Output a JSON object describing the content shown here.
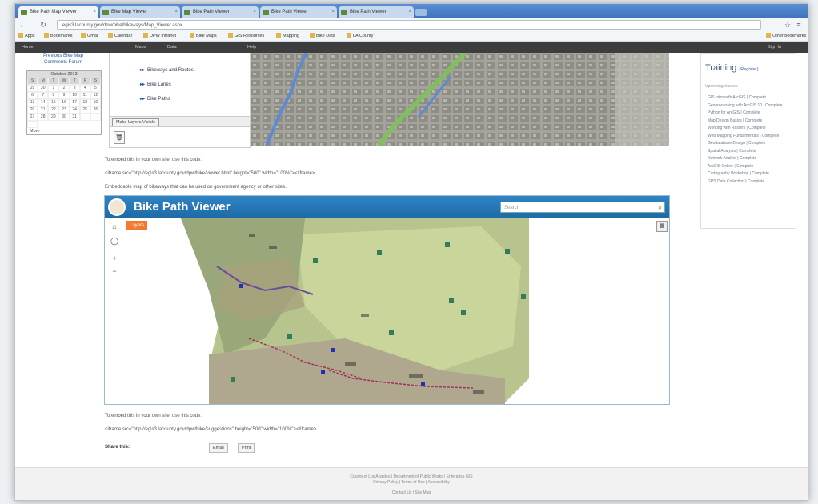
{
  "browser": {
    "tabs": [
      {
        "label": "Bike Path Map Viewer"
      },
      {
        "label": "Bike Map Viewer"
      },
      {
        "label": "Bike Path Viewer"
      },
      {
        "label": "Bike Path Viewer"
      },
      {
        "label": "Bike Path Viewer"
      }
    ],
    "url": "egis3.lacounty.gov/dpw/bike/bikeways/Map_Viewer.aspx",
    "bookmarks": [
      "Apps",
      "Bookmarks",
      "Gmail",
      "Calendar",
      "DPW Intranet",
      "Bike Maps",
      "GIS Resources",
      "Mapping",
      "Bike Data",
      "LA County",
      "Other bookmarks"
    ]
  },
  "top_bar": {
    "items": [
      "Home",
      "Maps",
      "Data",
      "Help",
      "Sign In"
    ]
  },
  "sidebar": {
    "links": [
      "Previous Bike Map",
      "Comments Forum"
    ],
    "calendar_title": "October 2013",
    "weekdays": [
      "S",
      "M",
      "T",
      "W",
      "T",
      "F",
      "S"
    ],
    "days": [
      "29",
      "30",
      "1",
      "2",
      "3",
      "4",
      "5",
      "6",
      "7",
      "8",
      "9",
      "10",
      "11",
      "12",
      "13",
      "14",
      "15",
      "16",
      "17",
      "18",
      "19",
      "20",
      "21",
      "22",
      "23",
      "24",
      "25",
      "26",
      "27",
      "28",
      "29",
      "30",
      "31",
      "",
      "",
      ""
    ],
    "more": "More"
  },
  "layer_panel": {
    "items": [
      "Bikeways and Routes",
      "Bike Lanes",
      "Bike Paths"
    ],
    "button": "Make Layers Visible"
  },
  "embed1": {
    "instructions": "To embed this in your own site, use this code:",
    "code": "<iframe src=\"http://egis3.lacounty.gov/dpw/bike/viewer.html\" height=\"500\" width=\"100%\"></iframe>",
    "note": "Embeddable map of bikeways that can be used on government agency or other sites."
  },
  "viewer": {
    "title": "Bike Path Viewer",
    "search_placeholder": "Search",
    "layers_button": "Layers"
  },
  "embed2": {
    "instructions": "To embed this in your own site, use this code:",
    "code": "<iframe src=\"http://egis3.lacounty.gov/dpw/bike/suggestions\" height=\"500\" width=\"100%\"></iframe>"
  },
  "share": {
    "label": "Share this:",
    "buttons": [
      "Email",
      "Print"
    ]
  },
  "right_panel": {
    "title": "Training",
    "title_link": "(Register)",
    "subtitle": "Upcoming classes",
    "items": [
      "GIS Intro with ArcGIS | Complete",
      "Geoprocessing with ArcGIS 10 | Complete",
      "Python for ArcGIS | Complete",
      "Map Design Basics | Complete",
      "Working with Rasters | Complete",
      "Web Mapping Fundamentals | Complete",
      "Geodatabase Design | Complete",
      "Spatial Analysis | Complete",
      "Network Analyst | Complete",
      "ArcGIS Online | Complete",
      "Cartography Workshop | Complete",
      "GPS Data Collection | Complete"
    ]
  },
  "footer": {
    "lines": [
      "County of Los Angeles | Department of Public Works | Enterprise GIS",
      "Privacy Policy | Terms of Use | Accessibility",
      "Contact Us | Site Map"
    ]
  }
}
